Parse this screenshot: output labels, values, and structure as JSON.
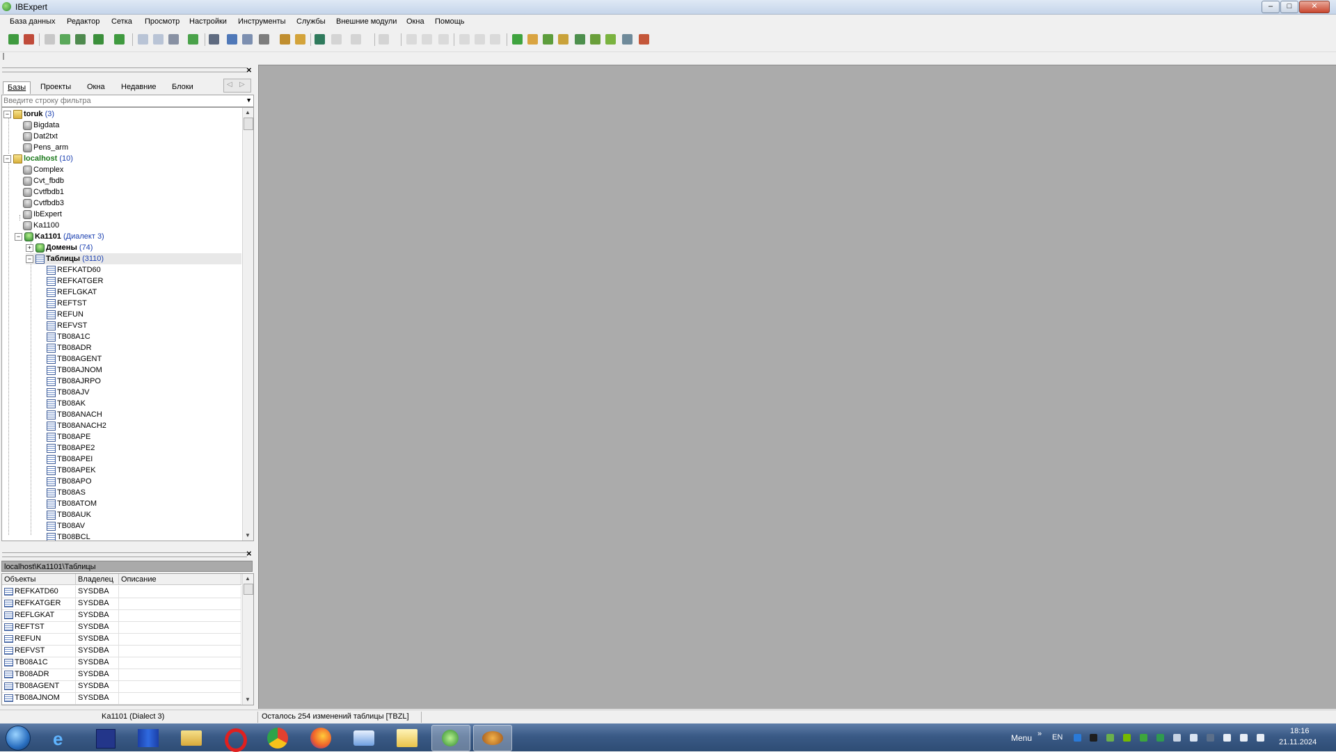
{
  "window": {
    "title": "IBExpert",
    "minimize": "–",
    "maximize": "□",
    "close": "✕"
  },
  "menu": [
    "База данных",
    "Редактор",
    "Сетка",
    "Просмотр",
    "Настройки",
    "Инструменты",
    "Службы",
    "Внешние модули",
    "Окна",
    "Помощь"
  ],
  "explorer": {
    "close": "×",
    "tabs": [
      "Базы",
      "Проекты",
      "Окна",
      "Недавние",
      "Блоки"
    ],
    "filter_placeholder": "Введите строку фильтра",
    "tree": {
      "server1": {
        "name": "toruk",
        "count": "(3)"
      },
      "server1_dbs": [
        "Bigdata",
        "Dat2txt",
        "Pens_arm"
      ],
      "server2": {
        "name": "localhost",
        "count": "(10)"
      },
      "server2_dbs": [
        "Complex",
        "Cvt_fbdb",
        "Cvtfbdb1",
        "Cvtfbdb3",
        "IbExpert",
        "Ka1100"
      ],
      "active_db": {
        "name": "Ka1101",
        "dialect": "(Диалект 3)"
      },
      "domains": {
        "name": "Домены",
        "count": "(74)"
      },
      "tables": {
        "name": "Таблицы",
        "count": "(3110)"
      },
      "table_items": [
        "REFKATD60",
        "REFKATGER",
        "REFLGKAT",
        "REFTST",
        "REFUN",
        "REFVST",
        "TB08A1C",
        "TB08ADR",
        "TB08AGENT",
        "TB08AJNOM",
        "TB08AJRPO",
        "TB08AJV",
        "TB08AK",
        "TB08ANACH",
        "TB08ANACH2",
        "TB08APE",
        "TB08APE2",
        "TB08APEI",
        "TB08APEK",
        "TB08APO",
        "TB08AS",
        "TB08ATOM",
        "TB08AUK",
        "TB08AV",
        "TB08BCL"
      ]
    }
  },
  "objects": {
    "close": "×",
    "path": "localhost\\Ka1101\\Таблицы",
    "columns": [
      "Объекты",
      "Владелец",
      "Описание"
    ],
    "rows": [
      {
        "name": "REFKATD60",
        "owner": "SYSDBA",
        "desc": ""
      },
      {
        "name": "REFKATGER",
        "owner": "SYSDBA",
        "desc": ""
      },
      {
        "name": "REFLGKAT",
        "owner": "SYSDBA",
        "desc": ""
      },
      {
        "name": "REFTST",
        "owner": "SYSDBA",
        "desc": ""
      },
      {
        "name": "REFUN",
        "owner": "SYSDBA",
        "desc": ""
      },
      {
        "name": "REFVST",
        "owner": "SYSDBA",
        "desc": ""
      },
      {
        "name": "TB08A1C",
        "owner": "SYSDBA",
        "desc": ""
      },
      {
        "name": "TB08ADR",
        "owner": "SYSDBA",
        "desc": ""
      },
      {
        "name": "TB08AGENT",
        "owner": "SYSDBA",
        "desc": ""
      },
      {
        "name": "TB08AJNOM",
        "owner": "SYSDBA",
        "desc": ""
      }
    ]
  },
  "status": {
    "db": "Ka1101 (Dialect 3)",
    "message": "Осталось 254 изменений таблицы [TBZL]"
  },
  "taskbar": {
    "menu": "Menu",
    "chevron": "»",
    "lang": "EN",
    "time": "18:16",
    "date": "21.11.2024"
  },
  "colors": {
    "workspace": "#ababab",
    "taskbar": "#3a5a86",
    "count_text": "#1a3fb0",
    "localhost_text": "#1d7a1d"
  }
}
